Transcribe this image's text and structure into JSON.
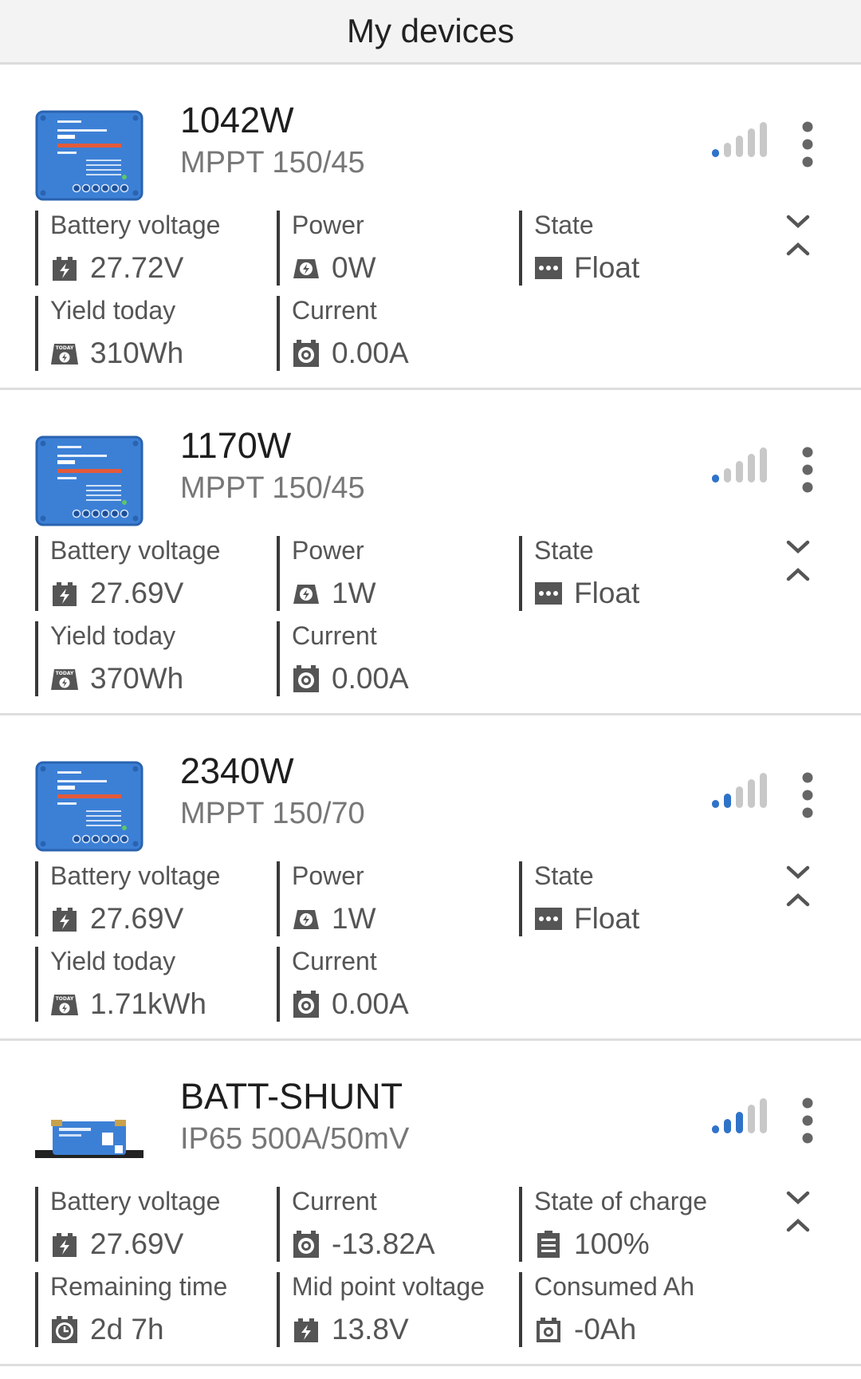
{
  "header": {
    "title": "My devices"
  },
  "devices": [
    {
      "name": "1042W",
      "model": "MPPT 150/45",
      "signal_level": 1,
      "metrics": [
        {
          "label": "Battery voltage",
          "value": "27.72V",
          "icon": "battery-bolt-icon"
        },
        {
          "label": "Power",
          "value": "0W",
          "icon": "solar-power-icon"
        },
        {
          "label": "State",
          "value": "Float",
          "icon": "state-dots-icon"
        },
        {
          "label": "Yield today",
          "value": "310Wh",
          "icon": "yield-today-icon"
        },
        {
          "label": "Current",
          "value": "0.00A",
          "icon": "current-clamp-icon"
        }
      ]
    },
    {
      "name": "1170W",
      "model": "MPPT 150/45",
      "signal_level": 1,
      "metrics": [
        {
          "label": "Battery voltage",
          "value": "27.69V",
          "icon": "battery-bolt-icon"
        },
        {
          "label": "Power",
          "value": "1W",
          "icon": "solar-power-icon"
        },
        {
          "label": "State",
          "value": "Float",
          "icon": "state-dots-icon"
        },
        {
          "label": "Yield today",
          "value": "370Wh",
          "icon": "yield-today-icon"
        },
        {
          "label": "Current",
          "value": "0.00A",
          "icon": "current-clamp-icon"
        }
      ]
    },
    {
      "name": "2340W",
      "model": "MPPT 150/70",
      "signal_level": 2,
      "metrics": [
        {
          "label": "Battery voltage",
          "value": "27.69V",
          "icon": "battery-bolt-icon"
        },
        {
          "label": "Power",
          "value": "1W",
          "icon": "solar-power-icon"
        },
        {
          "label": "State",
          "value": "Float",
          "icon": "state-dots-icon"
        },
        {
          "label": "Yield today",
          "value": "1.71kWh",
          "icon": "yield-today-icon"
        },
        {
          "label": "Current",
          "value": "0.00A",
          "icon": "current-clamp-icon"
        }
      ]
    },
    {
      "name": "BATT-SHUNT",
      "model": "IP65 500A/50mV",
      "signal_level": 3,
      "metrics": [
        {
          "label": "Battery voltage",
          "value": "27.69V",
          "icon": "battery-bolt-icon"
        },
        {
          "label": "Current",
          "value": "-13.82A",
          "icon": "current-clamp-icon"
        },
        {
          "label": "State of charge",
          "value": "100%",
          "icon": "battery-soc-icon"
        },
        {
          "label": "Remaining time",
          "value": "2d 7h",
          "icon": "clock-icon"
        },
        {
          "label": "Mid point voltage",
          "value": "13.8V",
          "icon": "battery-bolt-icon"
        },
        {
          "label": "Consumed Ah",
          "value": "-0Ah",
          "icon": "consumed-ah-icon"
        }
      ]
    }
  ],
  "colors": {
    "accent_blue": "#2f73c9",
    "signal_inactive": "#c8c8c8",
    "device_blue": "#3c80d6",
    "text_dark": "#1e1e1e",
    "text_muted": "#777777"
  }
}
